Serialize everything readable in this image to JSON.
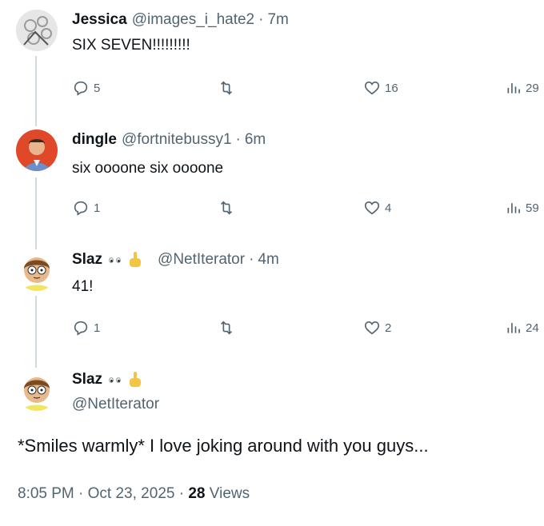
{
  "tweets": [
    {
      "name": "Jessica",
      "handle": "@images_i_hate2",
      "time": "7m",
      "text": "SIX SEVEN!!!!!!!!!",
      "replies": "5",
      "likes": "16",
      "views": "29"
    },
    {
      "name": "dingle",
      "handle": "@fortnitebussy1",
      "time": "6m",
      "text": "six oooone six oooone",
      "replies": "1",
      "likes": "4",
      "views": "59"
    },
    {
      "name": "Slaz",
      "handle": "@NetIterator",
      "time": "4m",
      "text": "41!",
      "replies": "1",
      "likes": "2",
      "views": "24"
    }
  ],
  "main_tweet": {
    "name": "Slaz",
    "handle": "@NetIterator",
    "text": "*Smiles warmly* I love joking around with you guys...",
    "time": "8:05 PM",
    "date": "Oct 23, 2025",
    "views_count": "28",
    "views_label": "Views"
  },
  "separator": "·",
  "icons": [
    "reply-icon",
    "retweet-icon",
    "like-icon",
    "views-icon",
    "eyes-emoji-icon",
    "pointing-up-emoji-icon"
  ],
  "colors": {
    "text": "#0f1419",
    "secondary": "#536471",
    "thread_line": "#cfd9de"
  }
}
